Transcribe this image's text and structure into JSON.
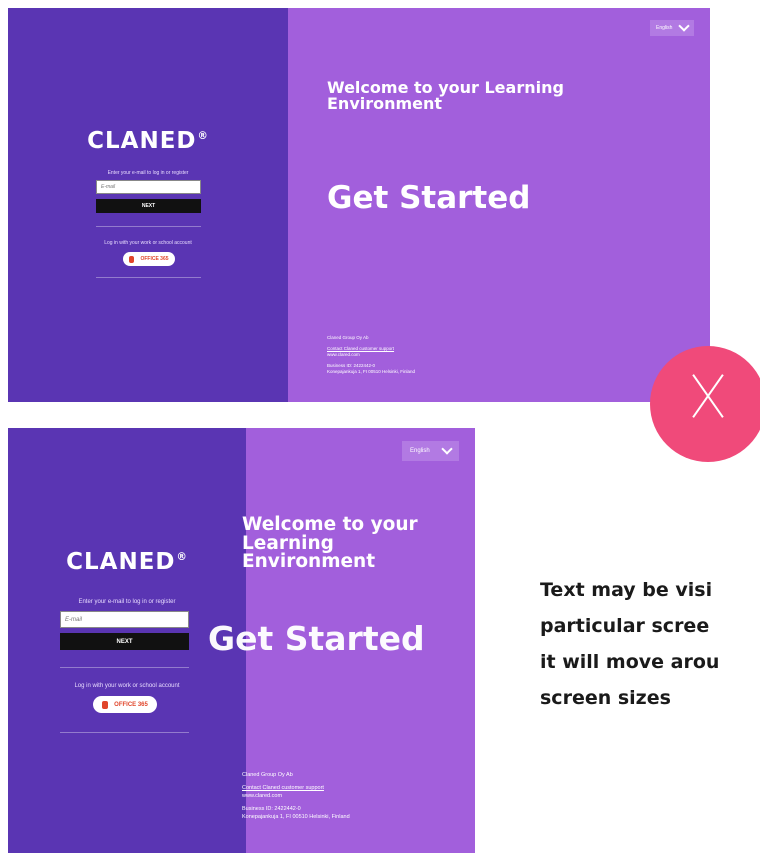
{
  "login": {
    "logo": "CLANED",
    "logo_mark": "®",
    "prompt": "Enter your e-mail to log in or register",
    "email_placeholder": "E-mail",
    "next_label": "NEXT",
    "alt_prompt": "Log in with your work or school account",
    "office_label": "OFFICE 365"
  },
  "hero": {
    "language": "English",
    "welcome": "Welcome to your Learning Environment",
    "get_started": "Get Started"
  },
  "footer": {
    "company": "Claned Group Oy Ab",
    "support_link": "Contact Claned customer support",
    "website": "www.clared.com",
    "business_id": "Business ID: 2422442-0",
    "address": "Konepajankuja 1, FI 00510 Helsinki, Finland"
  },
  "annotation": {
    "reject_mark": "X",
    "caption_lines": [
      "Text may be visi",
      "particular scree",
      "it will move arou",
      "screen sizes"
    ]
  },
  "colors": {
    "left_panel": "#5a35b3",
    "right_panel": "#a25fdc",
    "reject_badge": "#f04a7a"
  }
}
